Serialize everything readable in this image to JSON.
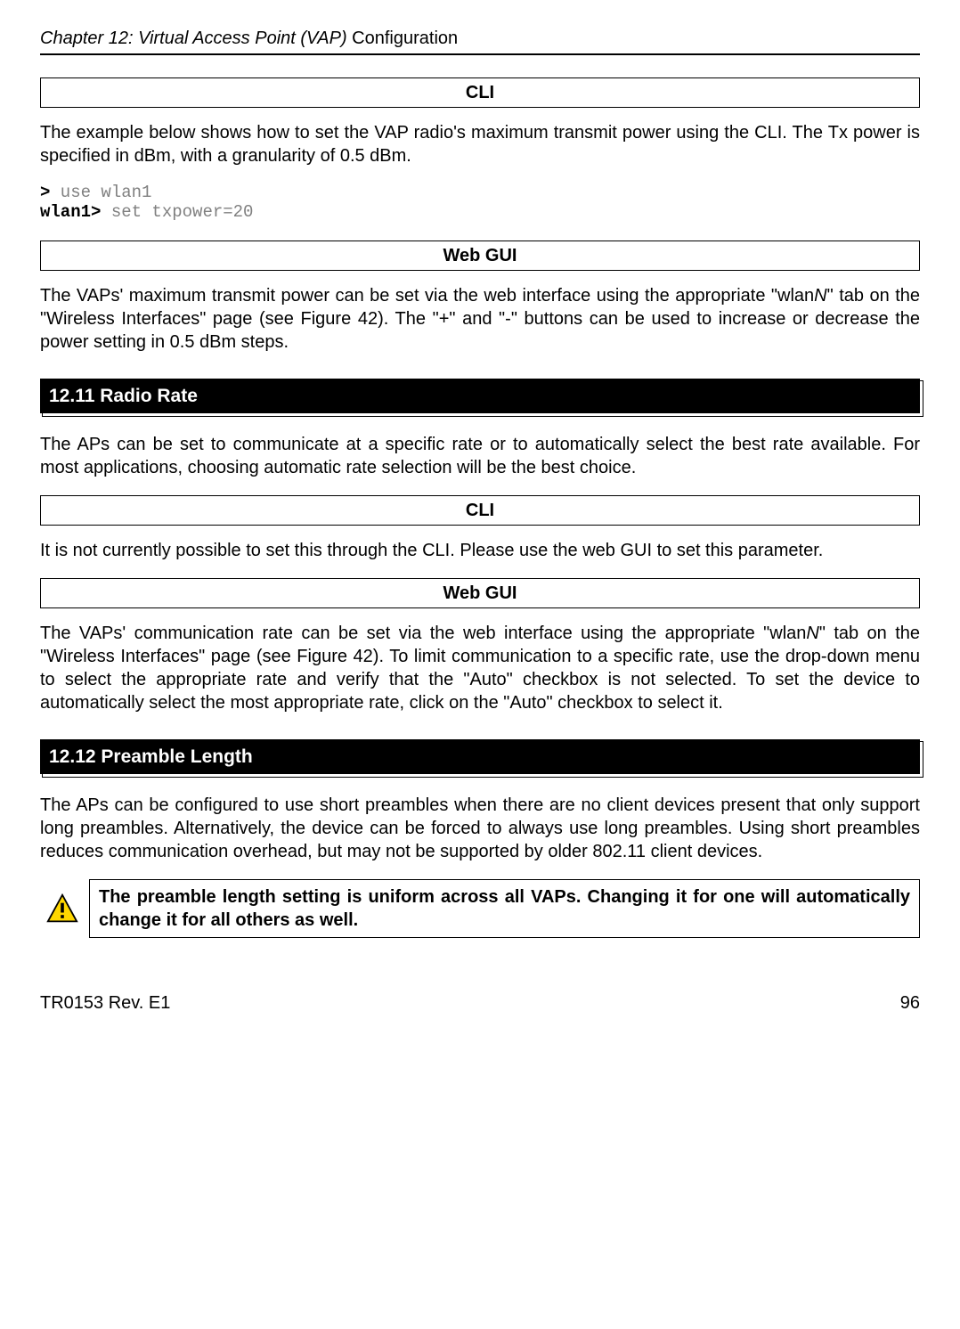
{
  "header": {
    "chapterPrefix": "Chapter 12: Virtual Access Point (VAP) ",
    "chapterSuffix": "Configuration"
  },
  "box1": "CLI",
  "para1": "The example below shows how to set the VAP radio's maximum transmit power using the CLI. The Tx power is specified in dBm, with a granularity of 0.5 dBm.",
  "code": {
    "prompt1": ">",
    "cmd1": " use wlan1",
    "prompt2": "wlan1>",
    "cmd2": " set txpower=20"
  },
  "box2": "Web GUI",
  "para2a": "The VAPs' maximum transmit power can be set via the web interface using the appropriate \"wlan",
  "para2b": "N",
  "para2c": "\" tab on the \"Wireless Interfaces\" page (see Figure 42). The \"+\" and \"-\" buttons can be used to increase or decrease the power setting in 0.5 dBm steps.",
  "section1": "12.11  Radio Rate",
  "para3": "The APs can be set to communicate at a specific rate or to automatically select the best rate available. For most applications, choosing automatic rate selection will be the best choice.",
  "box3": "CLI",
  "para4": "It is not currently possible to set this through the CLI. Please use the web GUI to set this parameter.",
  "box4": "Web GUI",
  "para5a": "The VAPs' communication rate can be set via the web interface using the appropriate \"wlan",
  "para5b": "N",
  "para5c": "\" tab on the \"Wireless Interfaces\" page (see Figure 42). To limit communication to a specific rate, use the drop-down menu to select the appropriate rate and verify that the \"Auto\" checkbox is not selected. To set the device to automatically select the most appropriate rate, click on the \"Auto\" checkbox to select it.",
  "section2": "12.12  Preamble Length",
  "para6": "The APs can be configured to use short preambles when there are no client devices present that only support long preambles. Alternatively, the device can be forced to always use long preambles. Using short preambles reduces communication overhead, but may not be supported by older 802.11 client devices.",
  "noteText": "The preamble length setting is uniform across all VAPs. Changing it for one will automatically change it for all others as well.",
  "footer": {
    "left": "TR0153 Rev. E1",
    "right": "96"
  }
}
